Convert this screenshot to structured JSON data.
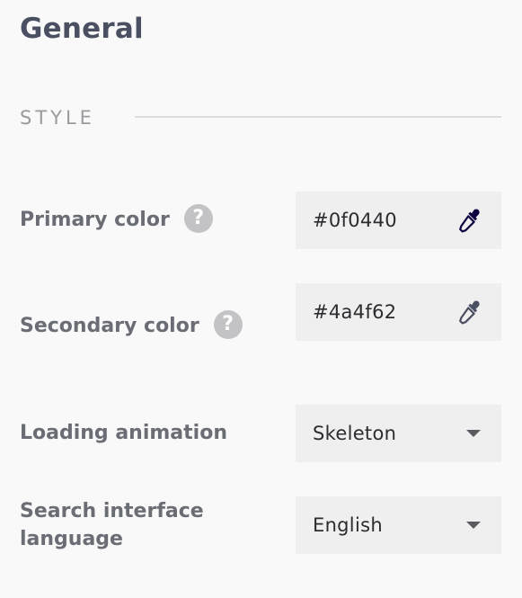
{
  "page": {
    "title": "General"
  },
  "section": {
    "label": "STYLE"
  },
  "rows": {
    "primary_color": {
      "label": "Primary color",
      "help": "?",
      "value": "#0f0440",
      "icon": "eyedropper-icon",
      "icon_color": "#0f0440"
    },
    "secondary_color": {
      "label": "Secondary color",
      "help": "?",
      "value": "#4a4f62",
      "icon": "eyedropper-icon",
      "icon_color": "#4a4f62"
    },
    "loading_animation": {
      "label": "Loading animation",
      "selected": "Skeleton",
      "icon": "chevron-down-icon"
    },
    "search_language": {
      "label_line1": "Search interface",
      "label_line2": "language",
      "selected": "English",
      "icon": "chevron-down-icon"
    }
  },
  "colors": {
    "title": "#4a4f62",
    "field_background": "#efefef"
  }
}
